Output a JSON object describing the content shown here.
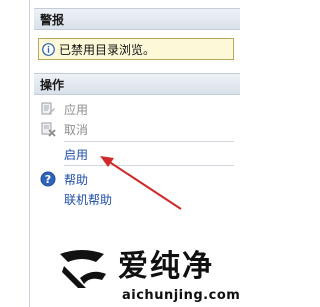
{
  "sections": {
    "alerts_title": "警报",
    "actions_title": "操作"
  },
  "alert": {
    "icon": "info-icon",
    "text": "已禁用目录浏览。"
  },
  "actions": {
    "apply": {
      "label": "应用",
      "icon": "apply-icon",
      "enabled": false
    },
    "cancel": {
      "label": "取消",
      "icon": "cancel-icon",
      "enabled": false
    },
    "enable": {
      "label": "启用",
      "enabled": true
    },
    "help": {
      "label": "帮助",
      "icon": "help-icon",
      "enabled": true
    },
    "online_help": {
      "label": "联机帮助",
      "enabled": true
    }
  },
  "watermark": {
    "title": "爱纯净",
    "url": "aichunjing.com"
  },
  "colors": {
    "link": "#1f4ea8",
    "disabled": "#8e8e8e",
    "alert_bg": "#fdf9d8",
    "arrow": "#d02a2a"
  }
}
